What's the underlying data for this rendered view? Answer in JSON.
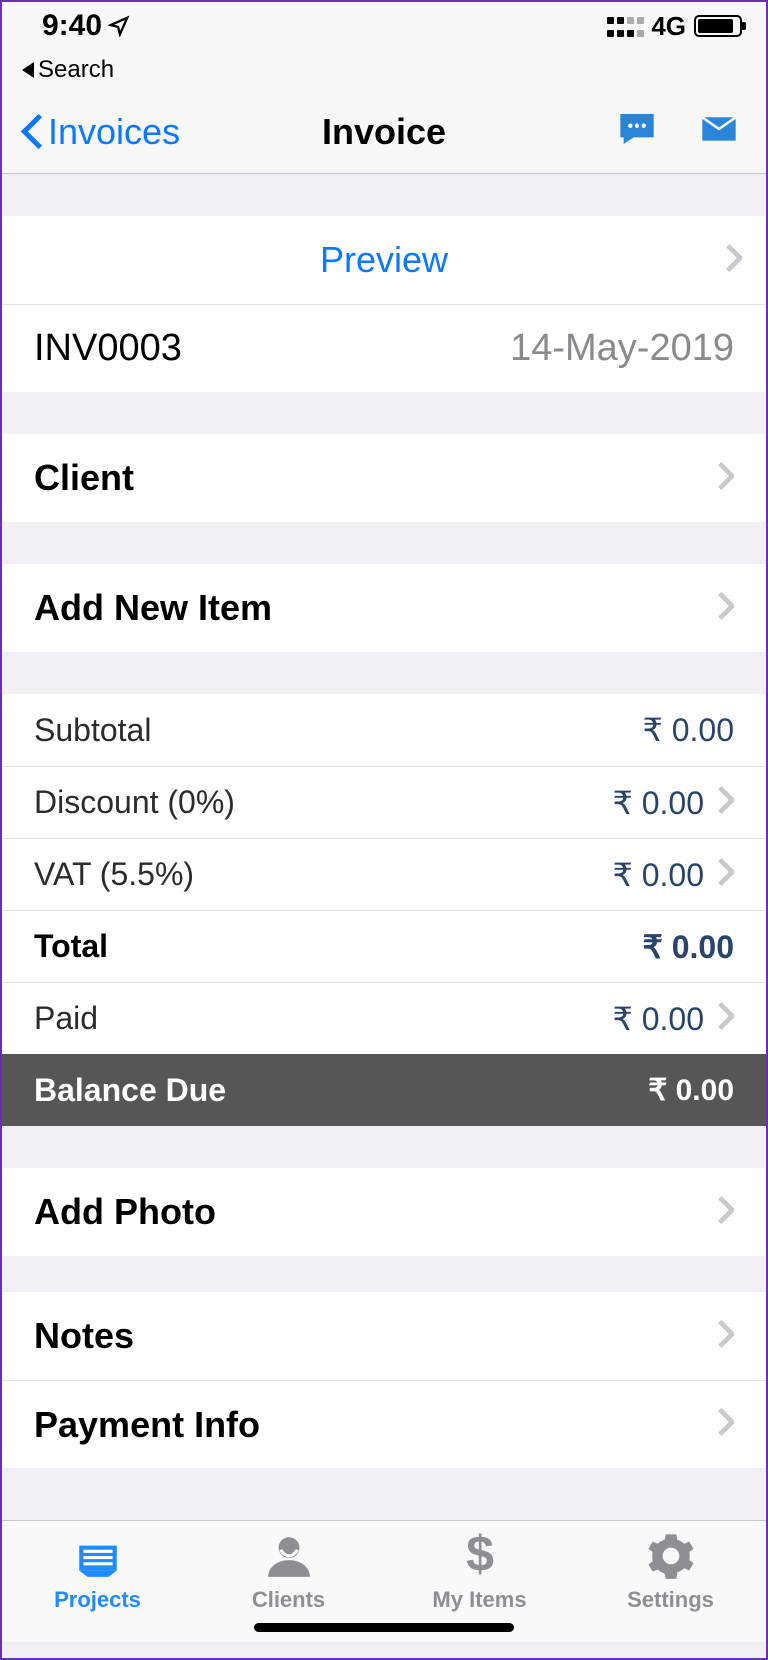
{
  "status": {
    "time": "9:40",
    "network": "4G",
    "back_search": "Search"
  },
  "nav": {
    "back": "Invoices",
    "title": "Invoice"
  },
  "preview": {
    "label": "Preview"
  },
  "invoice": {
    "number": "INV0003",
    "date": "14-May-2019"
  },
  "client": {
    "label": "Client"
  },
  "add_item": {
    "label": "Add New Item"
  },
  "amounts": {
    "subtotal": {
      "label": "Subtotal",
      "value": "₹ 0.00"
    },
    "discount": {
      "label": "Discount (0%)",
      "value": "₹ 0.00"
    },
    "vat": {
      "label": "VAT (5.5%)",
      "value": "₹ 0.00"
    },
    "total": {
      "label": "Total",
      "value": "₹ 0.00"
    },
    "paid": {
      "label": "Paid",
      "value": "₹ 0.00"
    },
    "balance": {
      "label": "Balance Due",
      "value": "₹ 0.00"
    }
  },
  "add_photo": {
    "label": "Add Photo"
  },
  "notes": {
    "label": "Notes"
  },
  "payment_info": {
    "label": "Payment Info"
  },
  "tabs": {
    "projects": "Projects",
    "clients": "Clients",
    "my_items": "My Items",
    "settings": "Settings"
  }
}
